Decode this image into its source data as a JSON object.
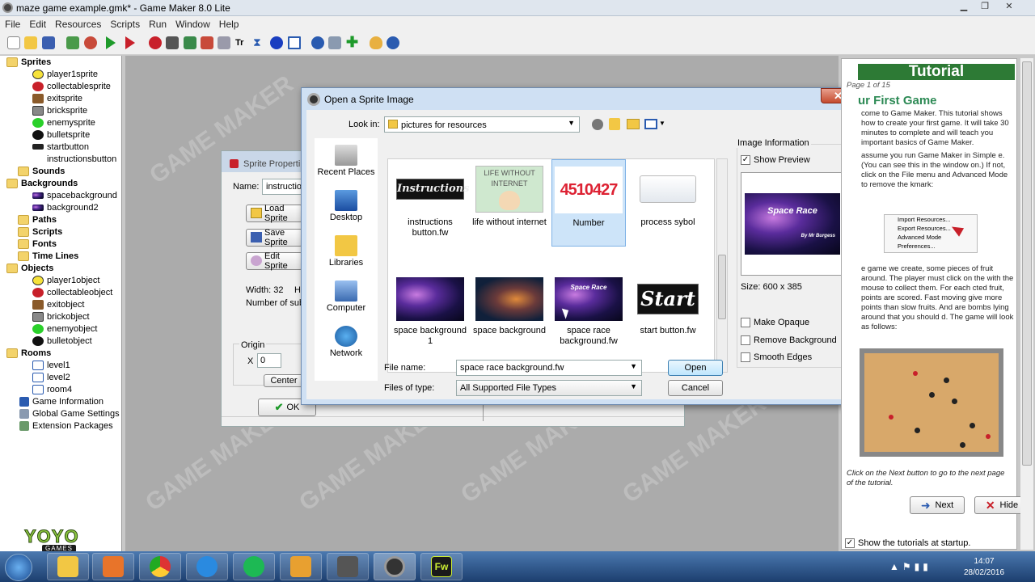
{
  "window": {
    "title": "maze game example.gmk* - Game Maker 8.0 Lite",
    "min": "▁",
    "max": "❐",
    "close": "✕"
  },
  "menu": [
    "File",
    "Edit",
    "Resources",
    "Scripts",
    "Run",
    "Window",
    "Help"
  ],
  "tree": {
    "sprites": {
      "label": "Sprites",
      "items": [
        "player1sprite",
        "collectablesprite",
        "exitsprite",
        "bricksprite",
        "enemysprite",
        "bulletsprite",
        "startbutton",
        "instructionsbutton"
      ]
    },
    "sounds": "Sounds",
    "backgrounds": {
      "label": "Backgrounds",
      "items": [
        "spacebackground",
        "background2"
      ]
    },
    "paths": "Paths",
    "scripts": "Scripts",
    "fonts": "Fonts",
    "timelines": "Time Lines",
    "objects": {
      "label": "Objects",
      "items": [
        "player1object",
        "collectableobject",
        "exitobject",
        "brickobject",
        "enemyobject",
        "bulletobject"
      ]
    },
    "rooms": {
      "label": "Rooms",
      "items": [
        "level1",
        "level2",
        "room4"
      ]
    },
    "extras": [
      "Game Information",
      "Global Game Settings",
      "Extension Packages"
    ]
  },
  "logo": {
    "main": "YOYO",
    "sub": "GAMES"
  },
  "watermark": "GAME MAKER",
  "sprite_props": {
    "title": "Sprite Properti",
    "name_label": "Name:",
    "name_value": "instruction",
    "load": "Load Sprite",
    "save": "Save Sprite",
    "edit": "Edit Sprite",
    "width": "Width: 32",
    "height": "He",
    "subimages": "Number of subim",
    "origin": "Origin",
    "x_label": "X",
    "x_value": "0",
    "center": "Center",
    "ok": "OK"
  },
  "dialog": {
    "title": "Open a Sprite Image",
    "close": "✕",
    "look_in_label": "Look in:",
    "look_in_value": "pictures for resources",
    "places": [
      "Recent Places",
      "Desktop",
      "Libraries",
      "Computer",
      "Network"
    ],
    "files": [
      {
        "label": "instructions button.fw",
        "thumb_text": "Instructions",
        "selected": false
      },
      {
        "label": "life without internet",
        "thumb_text": "LIFE WITHOUT INTERNET",
        "selected": false
      },
      {
        "label": "Number",
        "thumb_text": "4510427",
        "selected": true
      },
      {
        "label": "process sybol",
        "thumb_text": "",
        "selected": false
      },
      {
        "label": "space background 1",
        "thumb_text": "",
        "selected": false
      },
      {
        "label": "space background",
        "thumb_text": "",
        "selected": false
      },
      {
        "label": "space race background.fw",
        "thumb_text": "Space Race",
        "selected": false
      },
      {
        "label": "start button.fw",
        "thumb_text": "Start",
        "selected": false
      }
    ],
    "image_info": "Image Information",
    "show_preview": "Show Preview",
    "show_preview_checked": true,
    "preview_text": "Space Race",
    "preview_sub": "By Mr Burgess",
    "size": "Size: 600 x 385",
    "options": [
      "Make Opaque",
      "Remove Background",
      "Smooth Edges"
    ],
    "file_name_label": "File name:",
    "file_name_value": "space race background.fw",
    "file_type_label": "Files of type:",
    "file_type_value": "All Supported File Types",
    "open": "Open",
    "cancel": "Cancel"
  },
  "tutorial": {
    "title": "Tutorial",
    "page": "Page 1 of 15",
    "heading": "ur First Game",
    "p1": "come to Game Maker. This tutorial shows how to create your first game. It will take 30 minutes to complete and will teach you important basics of Game Maker.",
    "p2": "assume you run Game Maker in Simple e. (You can see this in the window on.) If not, click on the File menu and Advanced Mode to remove the kmark:",
    "menu_items": [
      "Import Resources...",
      "Export Resources...",
      "Advanced Mode",
      "Preferences..."
    ],
    "p3": "e game we create, some pieces of fruit around. The player must click on the with the mouse to collect them. For each cted fruit, points are scored. Fast moving give more points than slow fruits. And are bombs lying around that you should d. The game will look as follows:",
    "footer": "Click on the Next button to go to the next page of the tutorial.",
    "next": "Next",
    "hide": "Hide",
    "show_at_startup": "Show the tutorials at startup."
  },
  "clock": {
    "time": "14:07",
    "date": "28/02/2016"
  }
}
